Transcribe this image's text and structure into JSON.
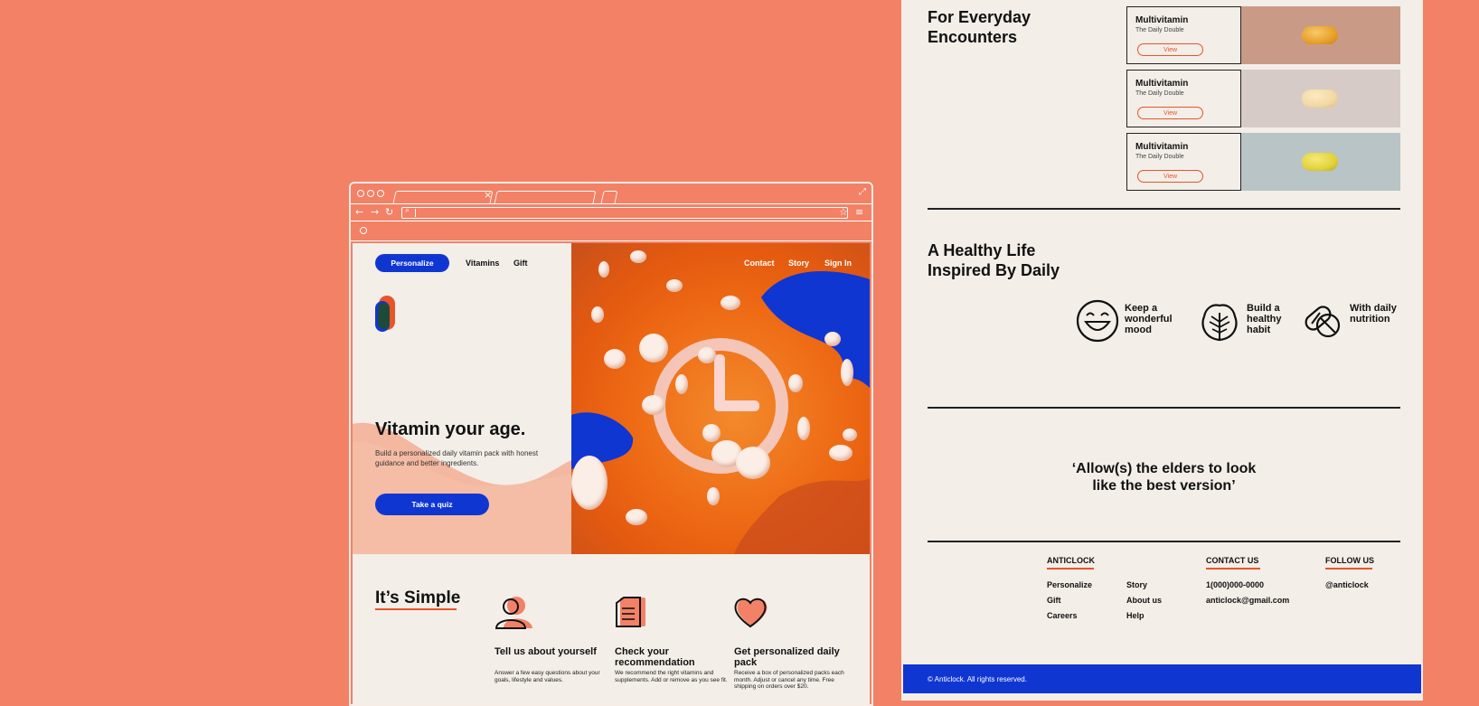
{
  "browser": {
    "nav": {
      "personalize": "Personalize",
      "vitamins": "Vitamins",
      "gift": "Gift",
      "contact": "Contact",
      "story": "Story",
      "signin": "Sign In"
    },
    "hero": {
      "headline": "Vitamin your age.",
      "subtext": "Build a personalized daily vitamin pack with honest guidance and better ingredients.",
      "cta": "Take a quiz"
    },
    "simple": {
      "title": "It’s Simple",
      "steps": [
        {
          "title": "Tell us about yourself",
          "desc": "Answer a few easy questions about your goals, lifestyle and values.",
          "icon": "person-icon"
        },
        {
          "title": "Check your recommendation",
          "desc": "We recommend the right vitamins and supplements. Add or remove as you see fit.",
          "icon": "document-icon"
        },
        {
          "title": "Get personalized daily pack",
          "desc": "Receive a box of personalized packs each month. Adjust or cancel any time. Free shipping on orders over $20.",
          "icon": "heart-icon"
        }
      ]
    },
    "colors": {
      "accent": "#1036D2",
      "orange": "#E8542A"
    }
  },
  "page": {
    "everyday_title": "For Everyday Encounters",
    "products": [
      {
        "name": "Multivitamin",
        "sub": "The Daily Double",
        "view": "View",
        "bg": "#C99B87",
        "capsule": "#E8A02A"
      },
      {
        "name": "Multivitamin",
        "sub": "The Daily Double",
        "view": "View",
        "bg": "#D7CBC8",
        "capsule": "#F1D9A3"
      },
      {
        "name": "Multivitamin",
        "sub": "The Daily Double",
        "view": "View",
        "bg": "#B8C4C6",
        "capsule": "#E3D23A"
      }
    ],
    "healthy_title": "A Healthy Life Inspired By Daily",
    "features": [
      {
        "label": "Keep a wonderful mood",
        "icon": "smile-icon"
      },
      {
        "label": "Build a healthy habit",
        "icon": "leaf-icon"
      },
      {
        "label": "With daily nutrition",
        "icon": "pill-icon"
      }
    ],
    "quote": "‘Allow(s) the elders to look like the best version’",
    "footer": {
      "brand": "ANTICLOCK",
      "col1": [
        "Personalize",
        "Gift",
        "Careers"
      ],
      "col2": [
        "Story",
        "About us",
        "Help"
      ],
      "contact_head": "CONTACT US",
      "phone": "1(000)000-0000",
      "email": "anticlock@gmail.com",
      "follow_head": "FOLLOW US",
      "handle": "@anticlock",
      "copyright": "© Anticlock. All rights reserved."
    }
  }
}
